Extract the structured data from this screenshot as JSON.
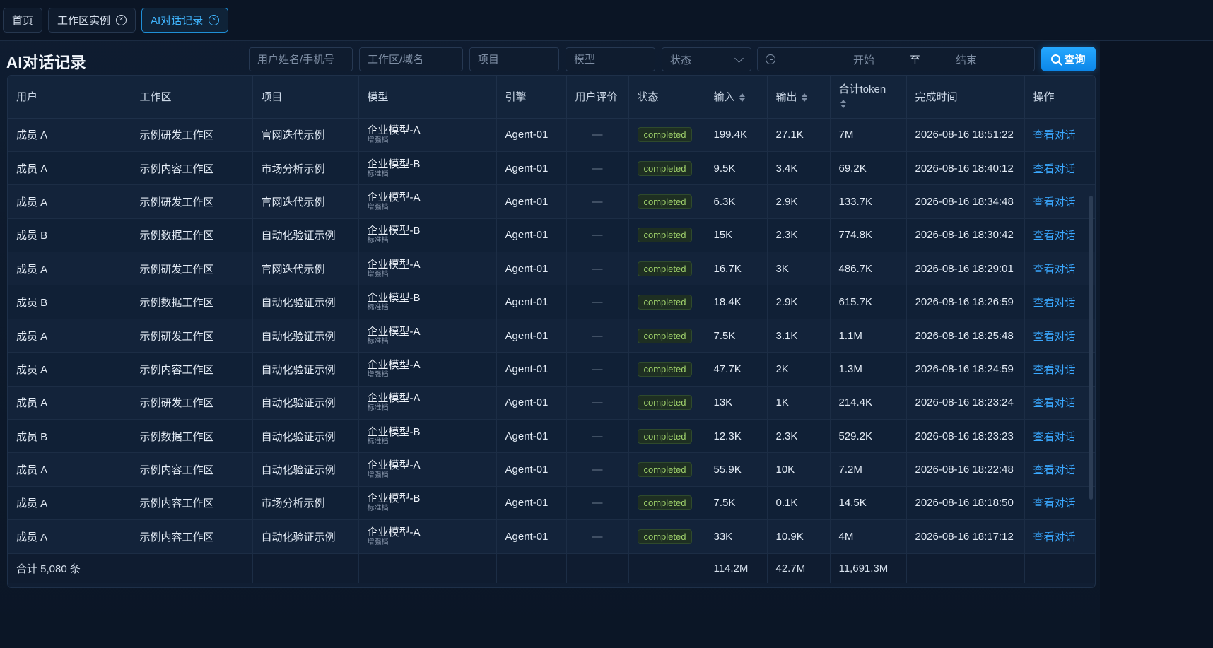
{
  "tabs": [
    {
      "label": "首页",
      "closable": false,
      "active": false
    },
    {
      "label": "工作区实例",
      "closable": true,
      "active": false
    },
    {
      "label": "AI对话记录",
      "closable": true,
      "active": true
    }
  ],
  "page": {
    "title": "AI对话记录"
  },
  "filters": {
    "user_placeholder": "用户姓名/手机号",
    "workspace_placeholder": "工作区/域名",
    "project_placeholder": "项目",
    "model_placeholder": "模型",
    "status_placeholder": "状态",
    "date_start": "开始",
    "date_sep": "至",
    "date_end": "结束",
    "query_label": "查询"
  },
  "table": {
    "headers": {
      "user": "用户",
      "workspace": "工作区",
      "project": "项目",
      "model": "模型",
      "engine": "引擎",
      "rating": "用户评价",
      "status": "状态",
      "input": "输入",
      "output": "输出",
      "total_token": "合计token",
      "finish_time": "完成时间",
      "action": "操作"
    },
    "rows": [
      {
        "user": "成员 A",
        "workspace": "示例研发工作区",
        "project": "官网迭代示例",
        "model": "企业模型-A",
        "model_tier": "增强档",
        "engine": "Agent-01",
        "rating": "—",
        "status": "completed",
        "input": "199.4K",
        "output": "27.1K",
        "total": "7M",
        "time": "2026-08-16 18:51:22",
        "action": "查看对话"
      },
      {
        "user": "成员 A",
        "workspace": "示例内容工作区",
        "project": "市场分析示例",
        "model": "企业模型-B",
        "model_tier": "标准档",
        "engine": "Agent-01",
        "rating": "—",
        "status": "completed",
        "input": "9.5K",
        "output": "3.4K",
        "total": "69.2K",
        "time": "2026-08-16 18:40:12",
        "action": "查看对话"
      },
      {
        "user": "成员 A",
        "workspace": "示例研发工作区",
        "project": "官网迭代示例",
        "model": "企业模型-A",
        "model_tier": "增强档",
        "engine": "Agent-01",
        "rating": "—",
        "status": "completed",
        "input": "6.3K",
        "output": "2.9K",
        "total": "133.7K",
        "time": "2026-08-16 18:34:48",
        "action": "查看对话"
      },
      {
        "user": "成员 B",
        "workspace": "示例数据工作区",
        "project": "自动化验证示例",
        "model": "企业模型-B",
        "model_tier": "标准档",
        "engine": "Agent-01",
        "rating": "—",
        "status": "completed",
        "input": "15K",
        "output": "2.3K",
        "total": "774.8K",
        "time": "2026-08-16 18:30:42",
        "action": "查看对话"
      },
      {
        "user": "成员 A",
        "workspace": "示例研发工作区",
        "project": "官网迭代示例",
        "model": "企业模型-A",
        "model_tier": "增强档",
        "engine": "Agent-01",
        "rating": "—",
        "status": "completed",
        "input": "16.7K",
        "output": "3K",
        "total": "486.7K",
        "time": "2026-08-16 18:29:01",
        "action": "查看对话"
      },
      {
        "user": "成员 B",
        "workspace": "示例数据工作区",
        "project": "自动化验证示例",
        "model": "企业模型-B",
        "model_tier": "标准档",
        "engine": "Agent-01",
        "rating": "—",
        "status": "completed",
        "input": "18.4K",
        "output": "2.9K",
        "total": "615.7K",
        "time": "2026-08-16 18:26:59",
        "action": "查看对话"
      },
      {
        "user": "成员 A",
        "workspace": "示例研发工作区",
        "project": "自动化验证示例",
        "model": "企业模型-A",
        "model_tier": "标准档",
        "engine": "Agent-01",
        "rating": "—",
        "status": "completed",
        "input": "7.5K",
        "output": "3.1K",
        "total": "1.1M",
        "time": "2026-08-16 18:25:48",
        "action": "查看对话"
      },
      {
        "user": "成员 A",
        "workspace": "示例内容工作区",
        "project": "自动化验证示例",
        "model": "企业模型-A",
        "model_tier": "增强档",
        "engine": "Agent-01",
        "rating": "—",
        "status": "completed",
        "input": "47.7K",
        "output": "2K",
        "total": "1.3M",
        "time": "2026-08-16 18:24:59",
        "action": "查看对话"
      },
      {
        "user": "成员 A",
        "workspace": "示例研发工作区",
        "project": "自动化验证示例",
        "model": "企业模型-A",
        "model_tier": "标准档",
        "engine": "Agent-01",
        "rating": "—",
        "status": "completed",
        "input": "13K",
        "output": "1K",
        "total": "214.4K",
        "time": "2026-08-16 18:23:24",
        "action": "查看对话"
      },
      {
        "user": "成员 B",
        "workspace": "示例数据工作区",
        "project": "自动化验证示例",
        "model": "企业模型-B",
        "model_tier": "标准档",
        "engine": "Agent-01",
        "rating": "—",
        "status": "completed",
        "input": "12.3K",
        "output": "2.3K",
        "total": "529.2K",
        "time": "2026-08-16 18:23:23",
        "action": "查看对话"
      },
      {
        "user": "成员 A",
        "workspace": "示例内容工作区",
        "project": "自动化验证示例",
        "model": "企业模型-A",
        "model_tier": "增强档",
        "engine": "Agent-01",
        "rating": "—",
        "status": "completed",
        "input": "55.9K",
        "output": "10K",
        "total": "7.2M",
        "time": "2026-08-16 18:22:48",
        "action": "查看对话"
      },
      {
        "user": "成员 A",
        "workspace": "示例内容工作区",
        "project": "市场分析示例",
        "model": "企业模型-B",
        "model_tier": "标准档",
        "engine": "Agent-01",
        "rating": "—",
        "status": "completed",
        "input": "7.5K",
        "output": "0.1K",
        "total": "14.5K",
        "time": "2026-08-16 18:18:50",
        "action": "查看对话"
      },
      {
        "user": "成员 A",
        "workspace": "示例内容工作区",
        "project": "自动化验证示例",
        "model": "企业模型-A",
        "model_tier": "增强档",
        "engine": "Agent-01",
        "rating": "—",
        "status": "completed",
        "input": "33K",
        "output": "10.9K",
        "total": "4M",
        "time": "2026-08-16 18:17:12",
        "action": "查看对话"
      }
    ],
    "footer": {
      "count": "合计 5,080 条",
      "input": "114.2M",
      "output": "42.7M",
      "total": "11,691.3M"
    }
  },
  "colors": {
    "accent": "#1e90ff",
    "status_completed": "#9fd16b",
    "link": "#3aa8ff"
  }
}
